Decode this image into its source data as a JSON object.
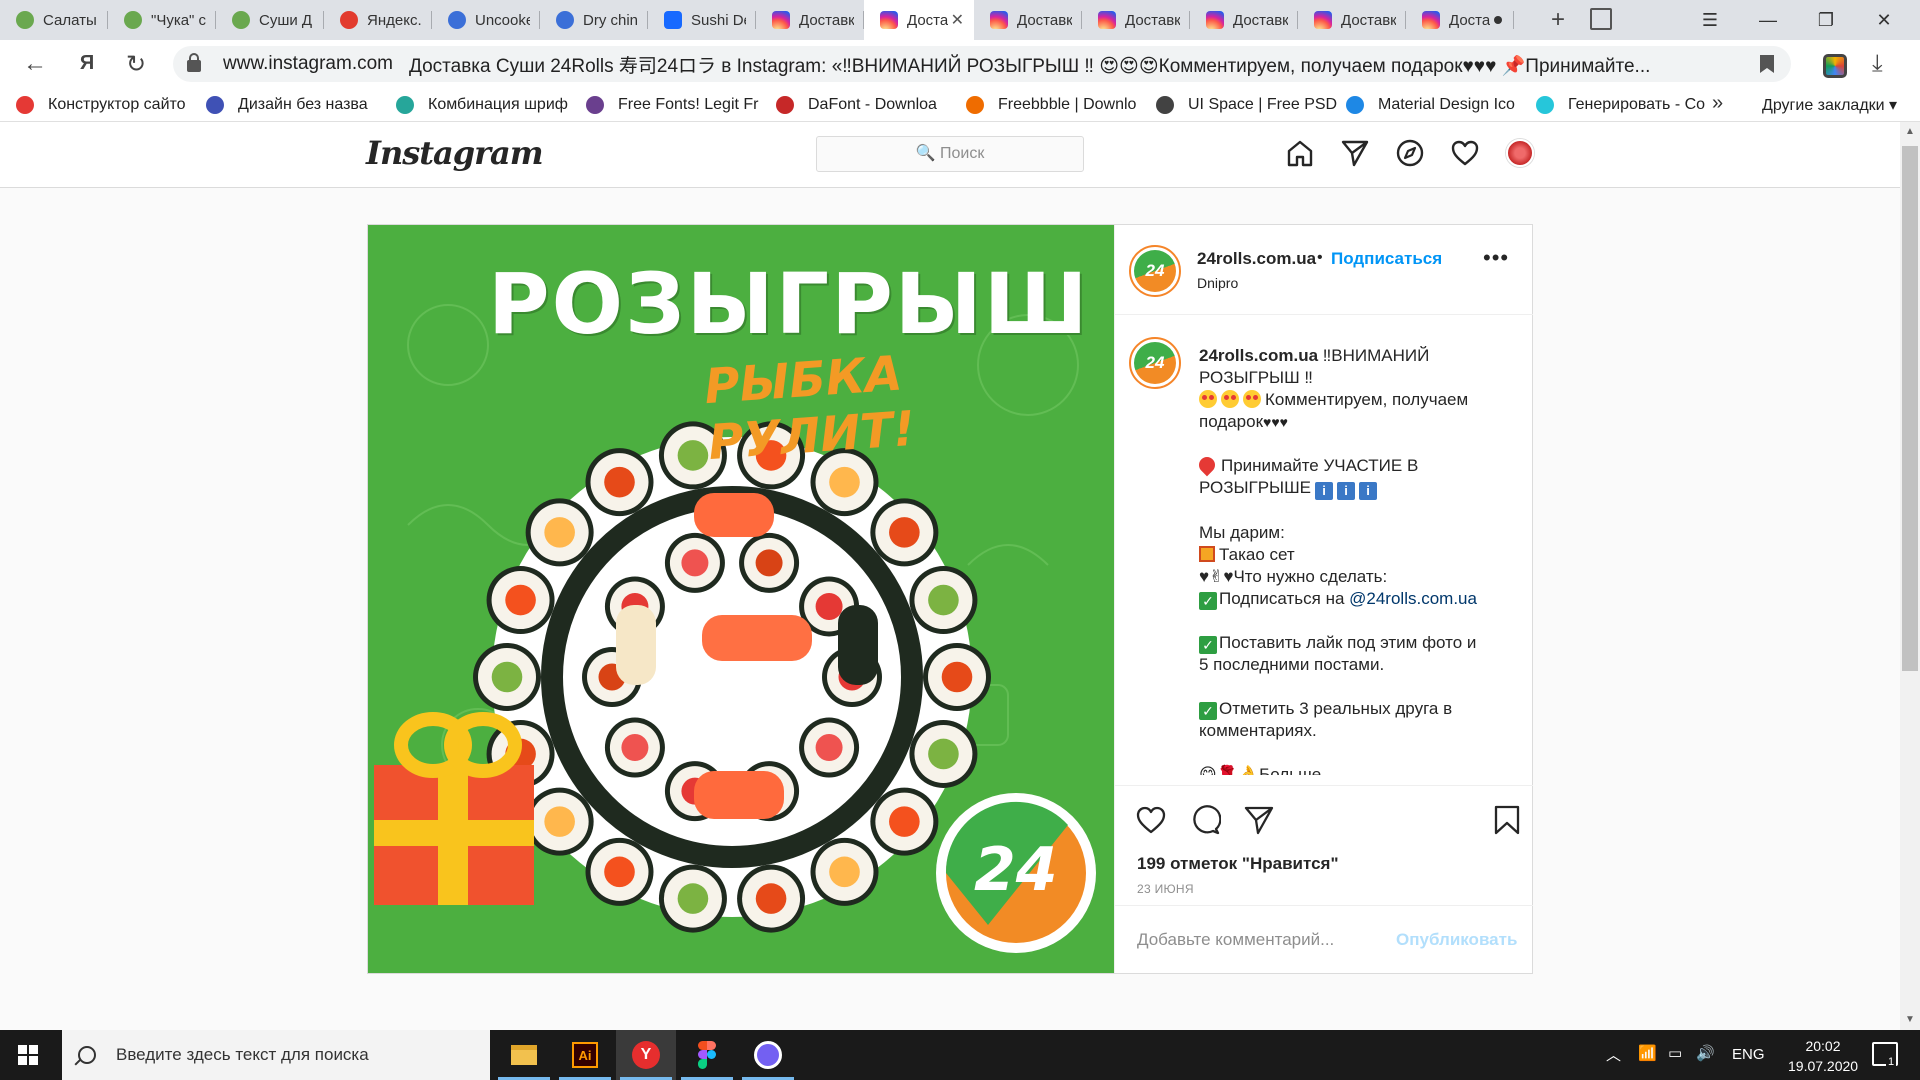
{
  "browser": {
    "tabs": [
      {
        "label": "Салаты",
        "icon": "grn"
      },
      {
        "label": "\"Чука\" с",
        "icon": "grn"
      },
      {
        "label": "Суши Д",
        "icon": "grn"
      },
      {
        "label": "Яндекс.",
        "icon": "red"
      },
      {
        "label": "Uncooke",
        "icon": "blu"
      },
      {
        "label": "Dry chin",
        "icon": "blu"
      },
      {
        "label": "Sushi De",
        "icon": "be"
      },
      {
        "label": "Доставк",
        "icon": "ig"
      },
      {
        "label": "Доста",
        "icon": "ig",
        "active": true
      },
      {
        "label": "Доставк",
        "icon": "ig"
      },
      {
        "label": "Доставк",
        "icon": "ig"
      },
      {
        "label": "Доставк",
        "icon": "ig"
      },
      {
        "label": "Доставк",
        "icon": "ig"
      },
      {
        "label": "Доста",
        "icon": "ig",
        "dot": true
      }
    ],
    "tab_close": "✕",
    "new_tab": "+",
    "window_controls": {
      "menu": "☰",
      "minimize": "—",
      "restore": "❐",
      "close": "✕"
    },
    "nav": {
      "back": "←",
      "yandex": "Я",
      "reload": "↻"
    },
    "url_domain": "www.instagram.com",
    "page_title": "Доставка Суши 24Rolls 寿司24ロラ в Instagram: «‼ВНИМАНИЙ РОЗЫГРЫШ ‼ 😍😍😍Комментируем, получаем подарок♥♥♥ 📌Принимайте...",
    "download": "⤓",
    "bookmarks": [
      {
        "label": "Конструктор сайто",
        "color": "#e53935"
      },
      {
        "label": "Дизайн без назва",
        "color": "#3f51b5"
      },
      {
        "label": "Комбинация шриф",
        "color": "#26a69a"
      },
      {
        "label": "Free Fonts! Legit Fr",
        "color": "#6a3f8e"
      },
      {
        "label": "DaFont - Downloa",
        "color": "#c62828"
      },
      {
        "label": "Freebbble | Downlo",
        "color": "#ef6c00"
      },
      {
        "label": "UI Space | Free PSD",
        "color": "#424242"
      },
      {
        "label": "Material Design Ico",
        "color": "#1e88e5"
      },
      {
        "label": "Генерировать - Со",
        "color": "#26c6da"
      }
    ],
    "bookmarks_more": "»",
    "other_bookmarks": "Другие закладки ▾"
  },
  "instagram": {
    "logo": "Instagram",
    "search_placeholder": "🔍 Поиск",
    "post": {
      "username": "24rolls.com.ua",
      "separator": "•",
      "follow": "Подписаться",
      "location": "Dnipro",
      "more": "•••",
      "avatar_text": "24",
      "caption": {
        "line1": "‼ВНИМАНИЙ",
        "line2": "РОЗЫГРЫШ ‼",
        "line3": "Комментируем, получаем",
        "line4": "подарок",
        "hearts": "♥♥♥",
        "line5": "Принимайте УЧАСТИЕ В",
        "line6": "РОЗЫГРЫШЕ",
        "info_glyph": "i",
        "line7": "Мы дарим:",
        "line8": "Такао сет",
        "line9": "Что нужно сделать:",
        "line9_prefix": "♥✌♥",
        "line10": "Подписаться на ",
        "mention": "@24rolls.com.ua",
        "line11": "Поставить лайк под этим фото и",
        "line12": "5 последними постами.",
        "line13": "Отметить 3 реальных друга в",
        "line14": "комментариях.",
        "line15_prefix": "😋🌹👌",
        "line15": "Больше",
        "check_glyph": "✓"
      },
      "likes": "199 отметок \"Нравится\"",
      "date": "23 ИЮНЯ",
      "comment_placeholder": "Добавьте комментарий...",
      "publish": "Опубликовать",
      "image_title": "РОЗЫГРЫШ",
      "image_subtitle": "РЫБКА РУЛИТ!",
      "image_badge": "24"
    }
  },
  "taskbar": {
    "search_placeholder": "Введите здесь текст для поиска",
    "apps": [
      "file-explorer",
      "illustrator",
      "yandex-browser",
      "figma",
      "viber"
    ],
    "illustrator_label": "Ai",
    "yandex_label": "Y",
    "lang": "ENG",
    "time": "20:02",
    "date": "19.07.2020",
    "notifications": "1"
  },
  "colors": {
    "ig_link": "#0095f6",
    "post_green": "#4caf40",
    "accent_orange": "#f39a25"
  }
}
